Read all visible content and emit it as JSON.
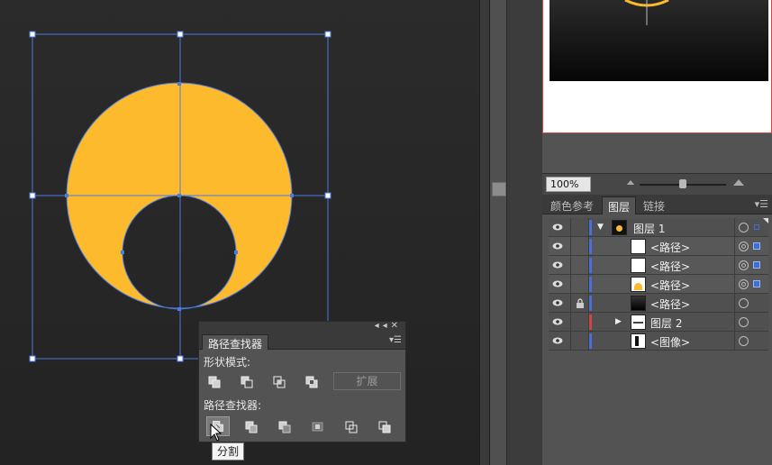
{
  "canvas": {
    "artwork_fill": "#FDBA2C",
    "selection_color": "#4A7BE0",
    "background_top": "#2b2b2b"
  },
  "navigator": {
    "zoom_value": "100%"
  },
  "layers_panel": {
    "tabs": [
      "颜色参考",
      "图层",
      "链接"
    ],
    "active_tab": "图层",
    "rows": [
      {
        "name": "图层 1",
        "expanded": true,
        "color": "#4a6fd8",
        "thumb": "layer1"
      },
      {
        "name": "<路径>",
        "color": "#4a6fd8",
        "thumb": "white",
        "selected": true
      },
      {
        "name": "<路径>",
        "color": "#4a6fd8",
        "thumb": "white",
        "selected": true
      },
      {
        "name": "<路径>",
        "color": "#4a6fd8",
        "thumb": "yellow",
        "selected": true
      },
      {
        "name": "<路径>",
        "color": "#4a6fd8",
        "thumb": "dark",
        "locked": true
      },
      {
        "name": "图层 2",
        "expanded": false,
        "color": "#d04646",
        "thumb": "layer2"
      },
      {
        "name": "<图像>",
        "color": "#4a6fd8",
        "thumb": "image"
      }
    ]
  },
  "pathfinder": {
    "title": "路径查找器",
    "shape_modes_label": "形状模式:",
    "expand_label": "扩展",
    "pathfinders_label": "路径查找器:",
    "tooltip": "分割"
  }
}
